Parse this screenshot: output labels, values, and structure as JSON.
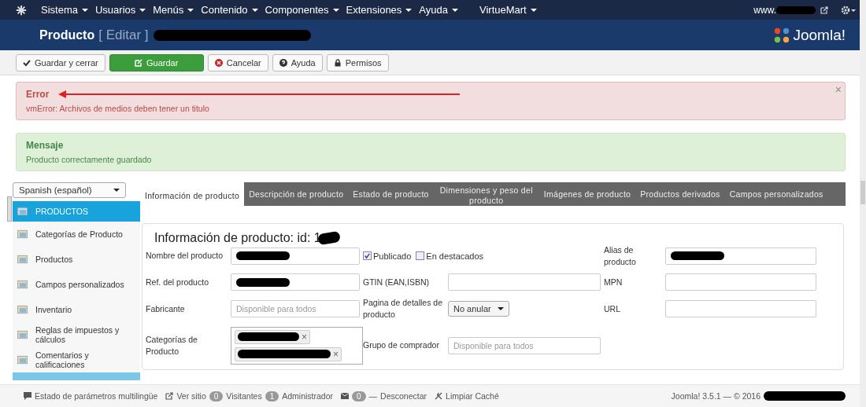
{
  "nav": {
    "menus": [
      "Sistema",
      "Usuarios",
      "Menús",
      "Contenido",
      "Componentes",
      "Extensiones",
      "Ayuda"
    ],
    "extra_menu": "VirtueMart",
    "site": "www."
  },
  "header": {
    "title": "Producto",
    "subtitle": "[ Editar ]",
    "brand": "Joomla!"
  },
  "toolbar": [
    {
      "label": "Guardar y cerrar",
      "kind": "default"
    },
    {
      "label": "Guardar",
      "kind": "primary"
    },
    {
      "label": "Cancelar",
      "kind": "default"
    },
    {
      "label": "Ayuda",
      "kind": "default"
    },
    {
      "label": "Permisos",
      "kind": "default"
    }
  ],
  "alerts": [
    {
      "kind": "error",
      "heading": "Error",
      "text": "vmError: Archivos de medios deben tener un titulo",
      "close": "×"
    },
    {
      "kind": "success",
      "heading": "Mensaje",
      "text": "Producto correctamente guardado"
    }
  ],
  "language": "Spanish (español)",
  "sidebar": {
    "items": [
      {
        "label": "PRODUCTOS",
        "selected": true
      },
      {
        "label": "Categorías de Producto",
        "selected": false
      },
      {
        "label": "Productos",
        "selected": false
      },
      {
        "label": "Campos personalizados",
        "selected": false
      },
      {
        "label": "Inventario",
        "selected": false
      },
      {
        "label": "Reglas de impuestos y cálculos",
        "selected": false
      },
      {
        "label": "Comentarios y calificaciones",
        "selected": false
      }
    ]
  },
  "tabs": [
    {
      "label": "Información de producto",
      "selected": true
    },
    {
      "label": "Descripción de producto",
      "selected": false
    },
    {
      "label": "Estado de producto",
      "selected": false
    },
    {
      "label": "Dimensiones y peso del producto",
      "selected": false
    },
    {
      "label": "Imágenes de producto",
      "selected": false
    },
    {
      "label": "Productos derivados",
      "selected": false
    },
    {
      "label": "Campos personalizados",
      "selected": false
    }
  ],
  "form": {
    "title": "Información de producto: id: 1",
    "rows": [
      [
        {
          "label": "Nombre del producto",
          "kind": "text",
          "redacted": true
        },
        {
          "kind": "checks",
          "checks": [
            {
              "label": "Publicado",
              "checked": true
            },
            {
              "label": "En destacados",
              "checked": false
            }
          ]
        },
        {
          "label": "Alias de producto",
          "kind": "text",
          "redacted": true
        }
      ],
      [
        {
          "label": "Ref. del producto",
          "kind": "text",
          "redacted": true
        },
        {
          "label": "GTIN (EAN,ISBN)",
          "kind": "text"
        },
        {
          "label": "MPN",
          "kind": "text"
        }
      ],
      [
        {
          "label": "Fabricante",
          "kind": "text",
          "placeholder": "Disponible para todos"
        },
        {
          "label": "Pagina de detalles de producto",
          "kind": "select",
          "value": "No anular"
        },
        {
          "label": "URL",
          "kind": "text"
        }
      ],
      [
        {
          "label": "Categorías de Producto",
          "kind": "tags",
          "tags": [
            {
              "redacted": true,
              "remove": "×"
            },
            {
              "redacted": true,
              "remove": "×"
            }
          ]
        },
        {
          "label": "Grupo de comprador",
          "kind": "text",
          "placeholder": "Disponible para todos"
        },
        {
          "kind": "empty"
        }
      ]
    ]
  },
  "footer": {
    "items": [
      {
        "kind": "text",
        "label": "Estado de parámetros multilingüe"
      },
      {
        "kind": "link",
        "label": "Ver sitio"
      },
      {
        "kind": "count",
        "count": "0",
        "label": "Visitantes"
      },
      {
        "kind": "count",
        "count": "1",
        "label": "Administrador"
      },
      {
        "kind": "mail",
        "count": "0",
        "label": "—"
      },
      {
        "kind": "text",
        "label": "Desconectar"
      },
      {
        "kind": "cache",
        "label": "Limpiar Caché"
      }
    ],
    "version": "Joomla! 3.5.1 — © 2016"
  }
}
